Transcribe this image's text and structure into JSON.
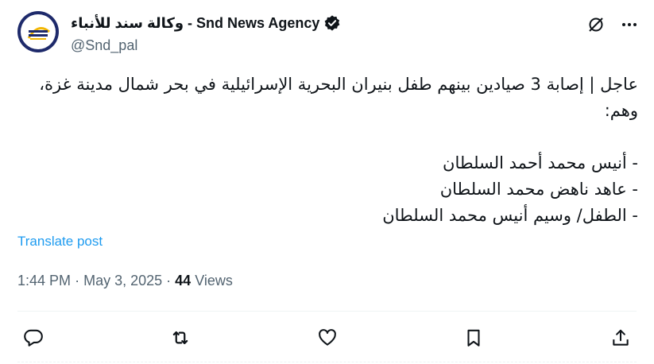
{
  "author": {
    "name": "وكالة سند للأنباء - Snd News Agency",
    "handle": "@Snd_pal",
    "verified": true,
    "avatar_icon": "snd-logo-icon"
  },
  "tweet": {
    "text": "عاجل | إصابة 3 صيادين بينهم طفل بنيران البحرية الإسرائيلية في بحر شمال مدينة غزة، وهم:\n\n- أنيس محمد أحمد السلطان\n- عاهد ناهض محمد السلطان\n- الطفل/ وسيم أنيس محمد السلطان",
    "translate_label": "Translate post",
    "time": "1:44 PM",
    "date": "May 3, 2025",
    "separator": "·",
    "views_count": "44",
    "views_label": "Views"
  },
  "icons": {
    "grok": "grok-icon",
    "more": "more-icon",
    "reply": "reply-icon",
    "repost": "repost-icon",
    "like": "like-icon",
    "bookmark": "bookmark-icon",
    "share": "share-icon"
  },
  "colors": {
    "text": "#0f1419",
    "secondary": "#536471",
    "link": "#1d9bf0",
    "divider": "#eff3f4",
    "avatar_ring": "#1e2a6b",
    "logo_gold": "#f2b705"
  }
}
